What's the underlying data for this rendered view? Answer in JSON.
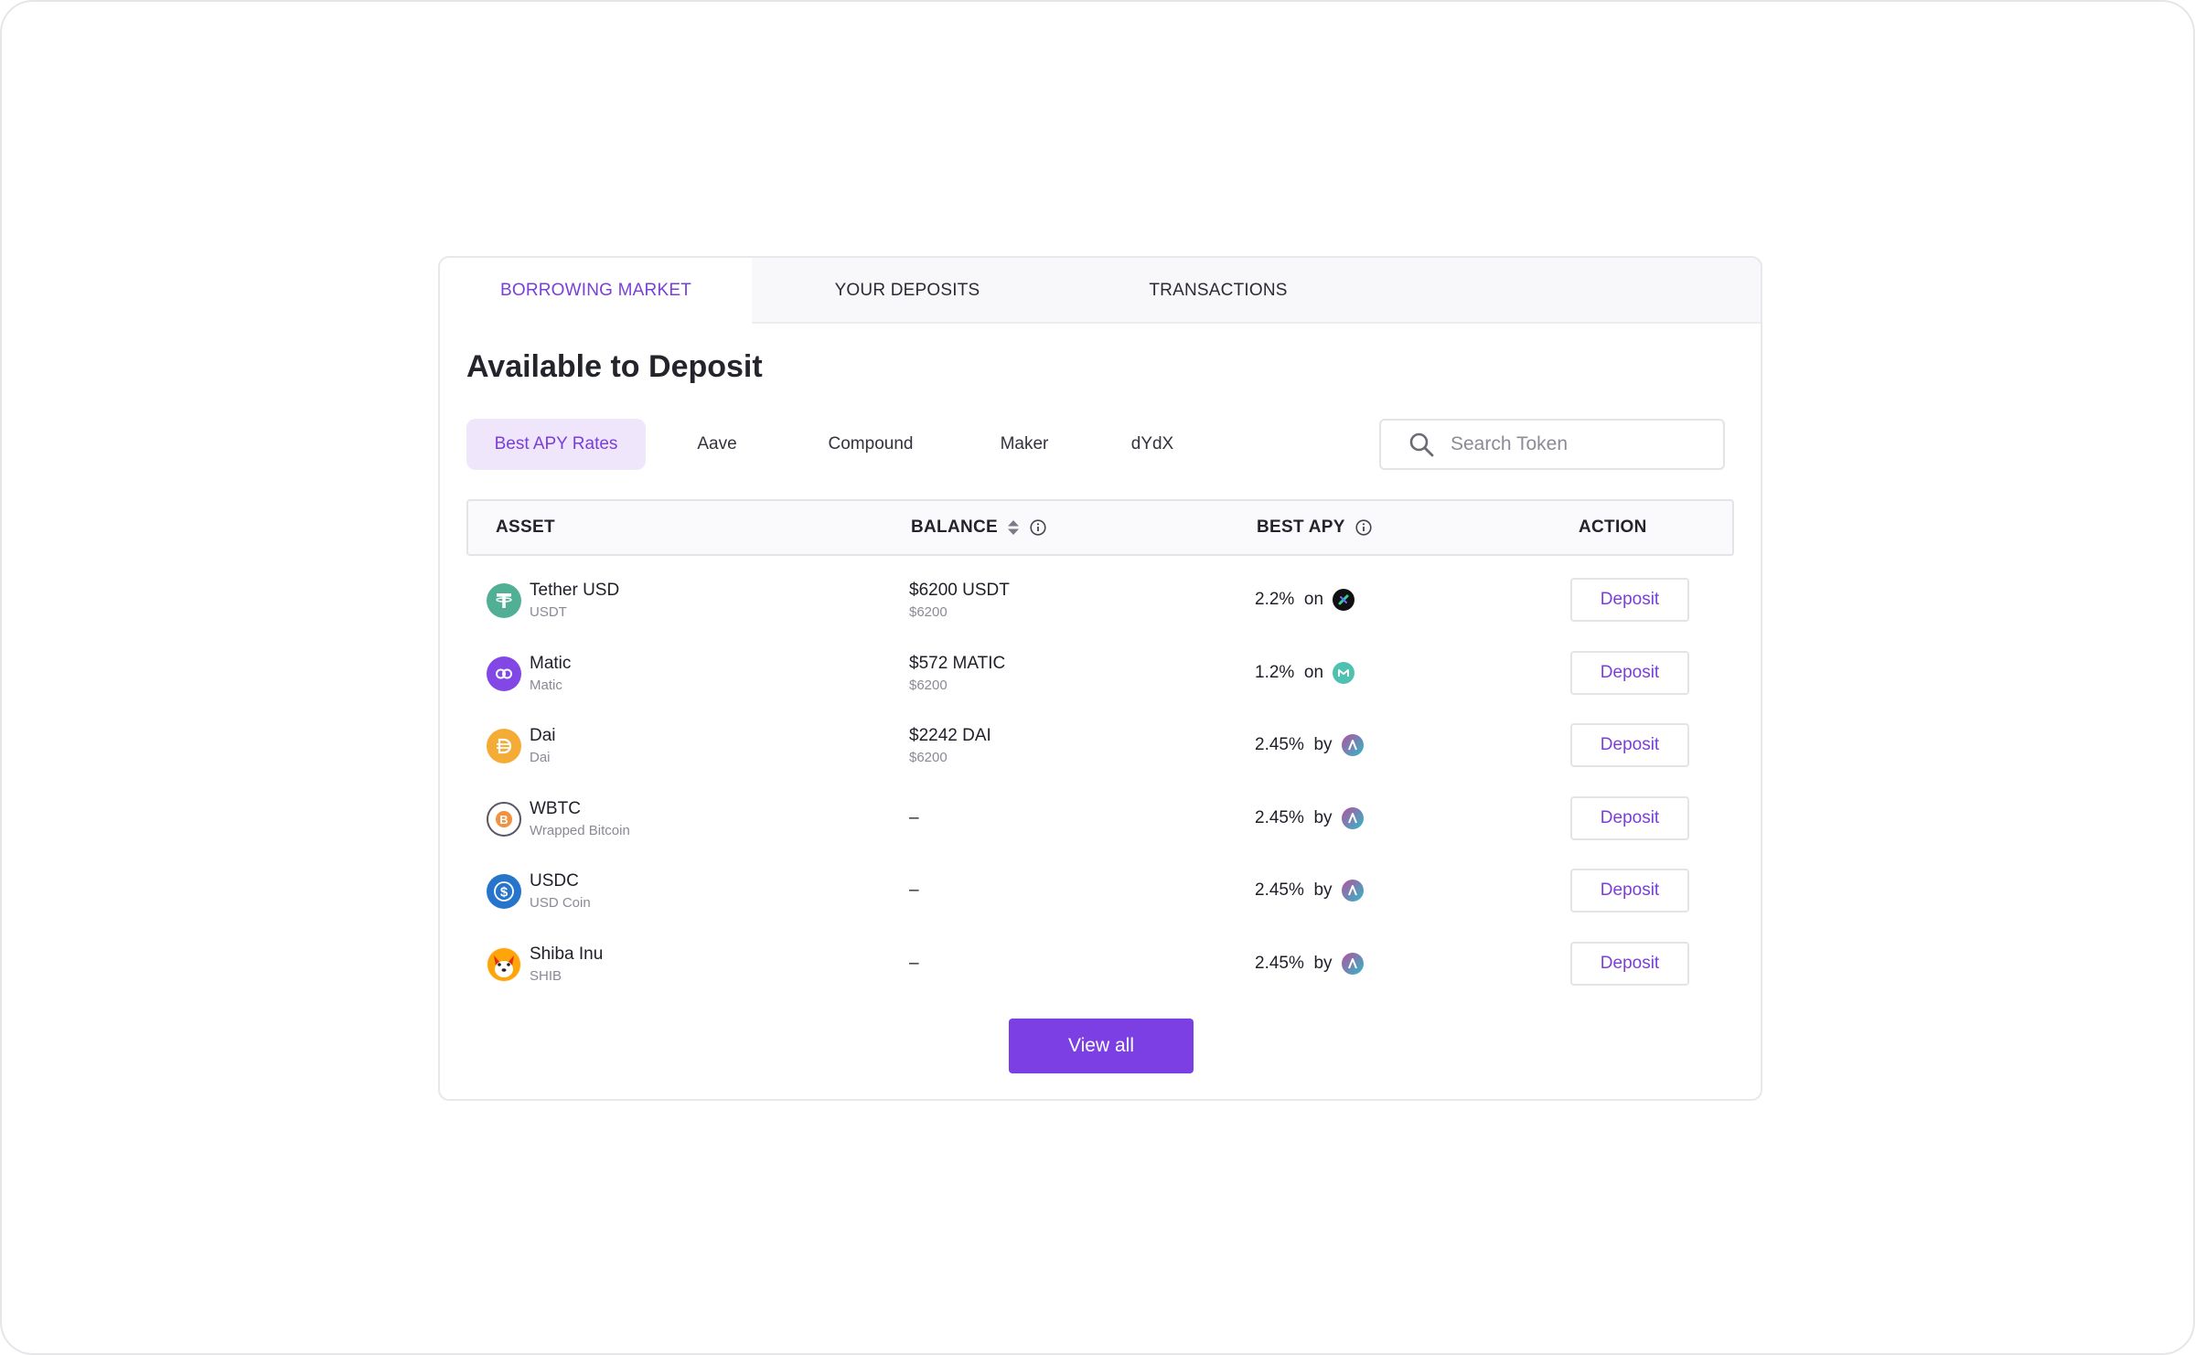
{
  "tabs": [
    {
      "label": "BORROWING MARKET",
      "active": true
    },
    {
      "label": "YOUR DEPOSITS",
      "active": false
    },
    {
      "label": "TRANSACTIONS",
      "active": false
    }
  ],
  "heading": "Available to Deposit",
  "filters": [
    {
      "label": "Best APY Rates",
      "active": true
    },
    {
      "label": "Aave",
      "active": false
    },
    {
      "label": "Compound",
      "active": false
    },
    {
      "label": "Maker",
      "active": false
    },
    {
      "label": "dYdX",
      "active": false
    }
  ],
  "search": {
    "placeholder": "Search Token",
    "icon": "search-icon"
  },
  "table": {
    "headers": {
      "asset": "ASSET",
      "balance": "BALANCE",
      "best_apy": "BEST APY",
      "action": "ACTION"
    },
    "rows": [
      {
        "name": "Tether USD",
        "symbol": "USDT",
        "balance": "$6200 USDT",
        "balance_usd": "$6200",
        "apy": "2.2%",
        "connector": "on",
        "protocol_icon": "dydx-icon",
        "action": "Deposit",
        "icon": "tether-icon",
        "color": "#50af95"
      },
      {
        "name": "Matic",
        "symbol": "Matic",
        "balance": "$572 MATIC",
        "balance_usd": "$6200",
        "apy": "1.2%",
        "connector": "on",
        "protocol_icon": "maker-icon",
        "action": "Deposit",
        "icon": "matic-icon",
        "color": "#8247e5"
      },
      {
        "name": "Dai",
        "symbol": "Dai",
        "balance": "$2242 DAI",
        "balance_usd": "$6200",
        "apy": "2.45%",
        "connector": "by",
        "protocol_icon": "aave-icon",
        "action": "Deposit",
        "icon": "dai-icon",
        "color": "#f5ac37"
      },
      {
        "name": "WBTC",
        "symbol": "Wrapped Bitcoin",
        "balance": "–",
        "balance_usd": "",
        "apy": "2.45%",
        "connector": "by",
        "protocol_icon": "aave-icon",
        "action": "Deposit",
        "icon": "wbtc-icon",
        "color": "#5a5564"
      },
      {
        "name": "USDC",
        "symbol": "USD Coin",
        "balance": "–",
        "balance_usd": "",
        "apy": "2.45%",
        "connector": "by",
        "protocol_icon": "aave-icon",
        "action": "Deposit",
        "icon": "usdc-icon",
        "color": "#2775ca"
      },
      {
        "name": "Shiba Inu",
        "symbol": "SHIB",
        "balance": "–",
        "balance_usd": "",
        "apy": "2.45%",
        "connector": "by",
        "protocol_icon": "aave-icon",
        "action": "Deposit",
        "icon": "shiba-icon",
        "color": "#e42d04"
      }
    ]
  },
  "view_all_label": "View all",
  "colors": {
    "accent": "#7b3fe4",
    "accent_soft": "#efe6fb",
    "border": "#e3e3e8"
  }
}
